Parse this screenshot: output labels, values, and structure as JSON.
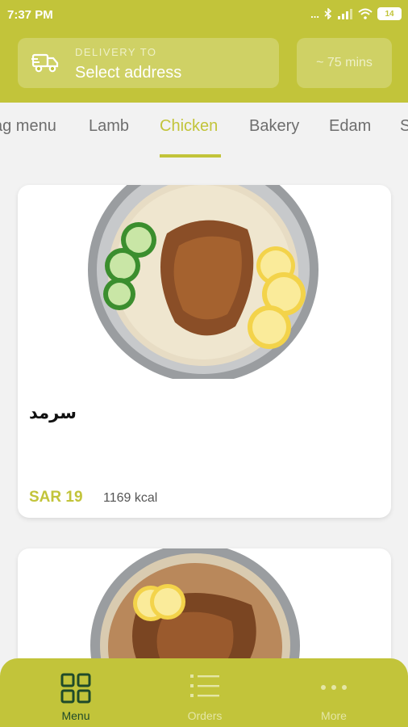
{
  "status": {
    "time": "7:37 PM",
    "dots": "...",
    "battery": "14"
  },
  "header": {
    "delivery_label": "DELIVERY TO",
    "address": "Select address",
    "eta": "~ 75 mins"
  },
  "tabs": [
    {
      "label": "ag menu",
      "active": false
    },
    {
      "label": "Lamb",
      "active": false
    },
    {
      "label": "Chicken",
      "active": true
    },
    {
      "label": "Bakery",
      "active": false
    },
    {
      "label": "Edam",
      "active": false
    },
    {
      "label": "S",
      "active": false
    }
  ],
  "items": [
    {
      "name": "سرمد",
      "price": "SAR 19",
      "kcal": "1169 kcal"
    }
  ],
  "nav": [
    {
      "label": "Menu",
      "icon": "grid-icon",
      "active": true
    },
    {
      "label": "Orders",
      "icon": "list-icon",
      "active": false
    },
    {
      "label": "More",
      "icon": "more-dots-icon",
      "active": false
    }
  ],
  "colors": {
    "accent": "#c2c43a",
    "active_nav": "#1f4a2a",
    "inactive_nav": "#e4e6a5"
  }
}
